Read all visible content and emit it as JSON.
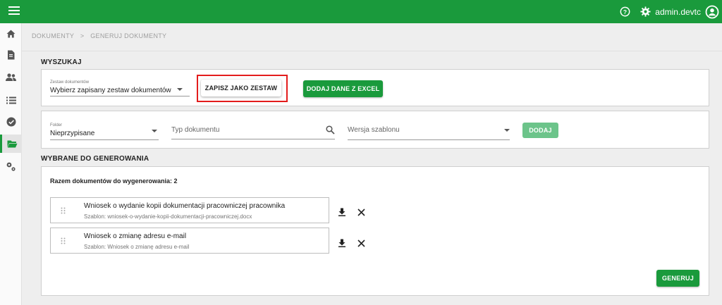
{
  "header": {
    "username": "admin.devtc",
    "icons": [
      "menu-icon",
      "help-icon",
      "gear-icon",
      "user-account-icon"
    ]
  },
  "sidebar": {
    "items": [
      {
        "icon": "home-icon"
      },
      {
        "icon": "document-icon"
      },
      {
        "icon": "people-icon"
      },
      {
        "icon": "list-icon"
      },
      {
        "icon": "check-circle-icon"
      },
      {
        "icon": "folder-open-icon",
        "active": true
      },
      {
        "icon": "settings-cogs-icon"
      }
    ]
  },
  "breadcrumb": {
    "items": [
      "DOKUMENTY",
      "GENERUJ DOKUMENTY"
    ]
  },
  "search": {
    "title": "WYSZUKAJ",
    "set_select": {
      "label": "Zestaw dokumentów",
      "value": "Wybierz zapisany zestaw dokumentów"
    },
    "save_set_button": "ZAPISZ JAKO ZESTAW",
    "add_excel_button": "DODAJ DANE Z EXCEL"
  },
  "filters": {
    "folder": {
      "label": "Folder",
      "value": "Nieprzypisane"
    },
    "doc_type_placeholder": "Typ dokumentu",
    "template_version_placeholder": "Wersja szablonu",
    "add_button": "DODAJ"
  },
  "selected": {
    "title": "WYBRANE DO GENEROWANIA",
    "total_label": "Razem dokumentów do wygenerowania: 2",
    "documents": [
      {
        "title": "Wniosek o wydanie kopii dokumentacji pracowniczej pracownika",
        "template": "Szablon: wniosek-o-wydanie-kopii-dokumentacji-pracowniczej.docx"
      },
      {
        "title": "Wniosek o zmianę adresu e-mail",
        "template": "Szablon: Wniosek o zmianę adresu e-mail"
      }
    ],
    "generate_button": "GENERUJ"
  },
  "colors": {
    "brand_green": "#1a9a3c",
    "highlight_red": "#e31c1c"
  }
}
